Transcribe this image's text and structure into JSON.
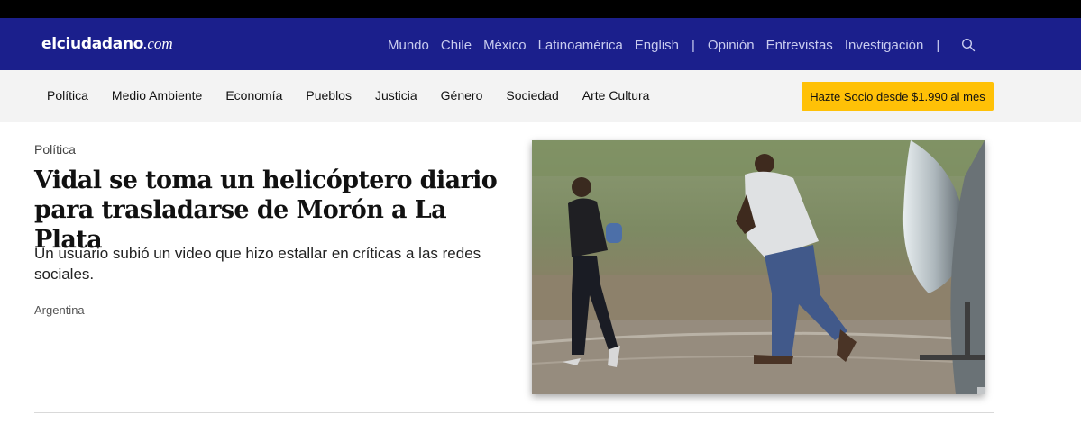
{
  "header": {
    "logo_brand": "elciudadano",
    "logo_tld": ".com",
    "nav_primary": [
      "Mundo",
      "Chile",
      "México",
      "Latinoamérica",
      "English"
    ],
    "nav_separator": "|",
    "nav_secondary": [
      "Opinión",
      "Entrevistas",
      "Investigación"
    ],
    "search_icon": "search-icon",
    "colors": {
      "nav_bg": "#1b1f8c",
      "nav_text": "#c9ccef",
      "top_strip": "#000000"
    }
  },
  "categories": {
    "items": [
      "Política",
      "Medio Ambiente",
      "Economía",
      "Pueblos",
      "Justicia",
      "Género",
      "Sociedad",
      "Arte Cultura"
    ],
    "cta_label": "Hazte Socio desde $1.990 al mes",
    "colors": {
      "bar_bg": "#f3f3f3",
      "cta_bg": "#ffc107"
    }
  },
  "article": {
    "section": "Política",
    "title": "Vidal se toma un helicóptero diario para trasladarse de Morón a La Plata",
    "lede": "Un usuario subió un video que hizo estallar en críticas a las redes sociales.",
    "tag": "Argentina"
  }
}
